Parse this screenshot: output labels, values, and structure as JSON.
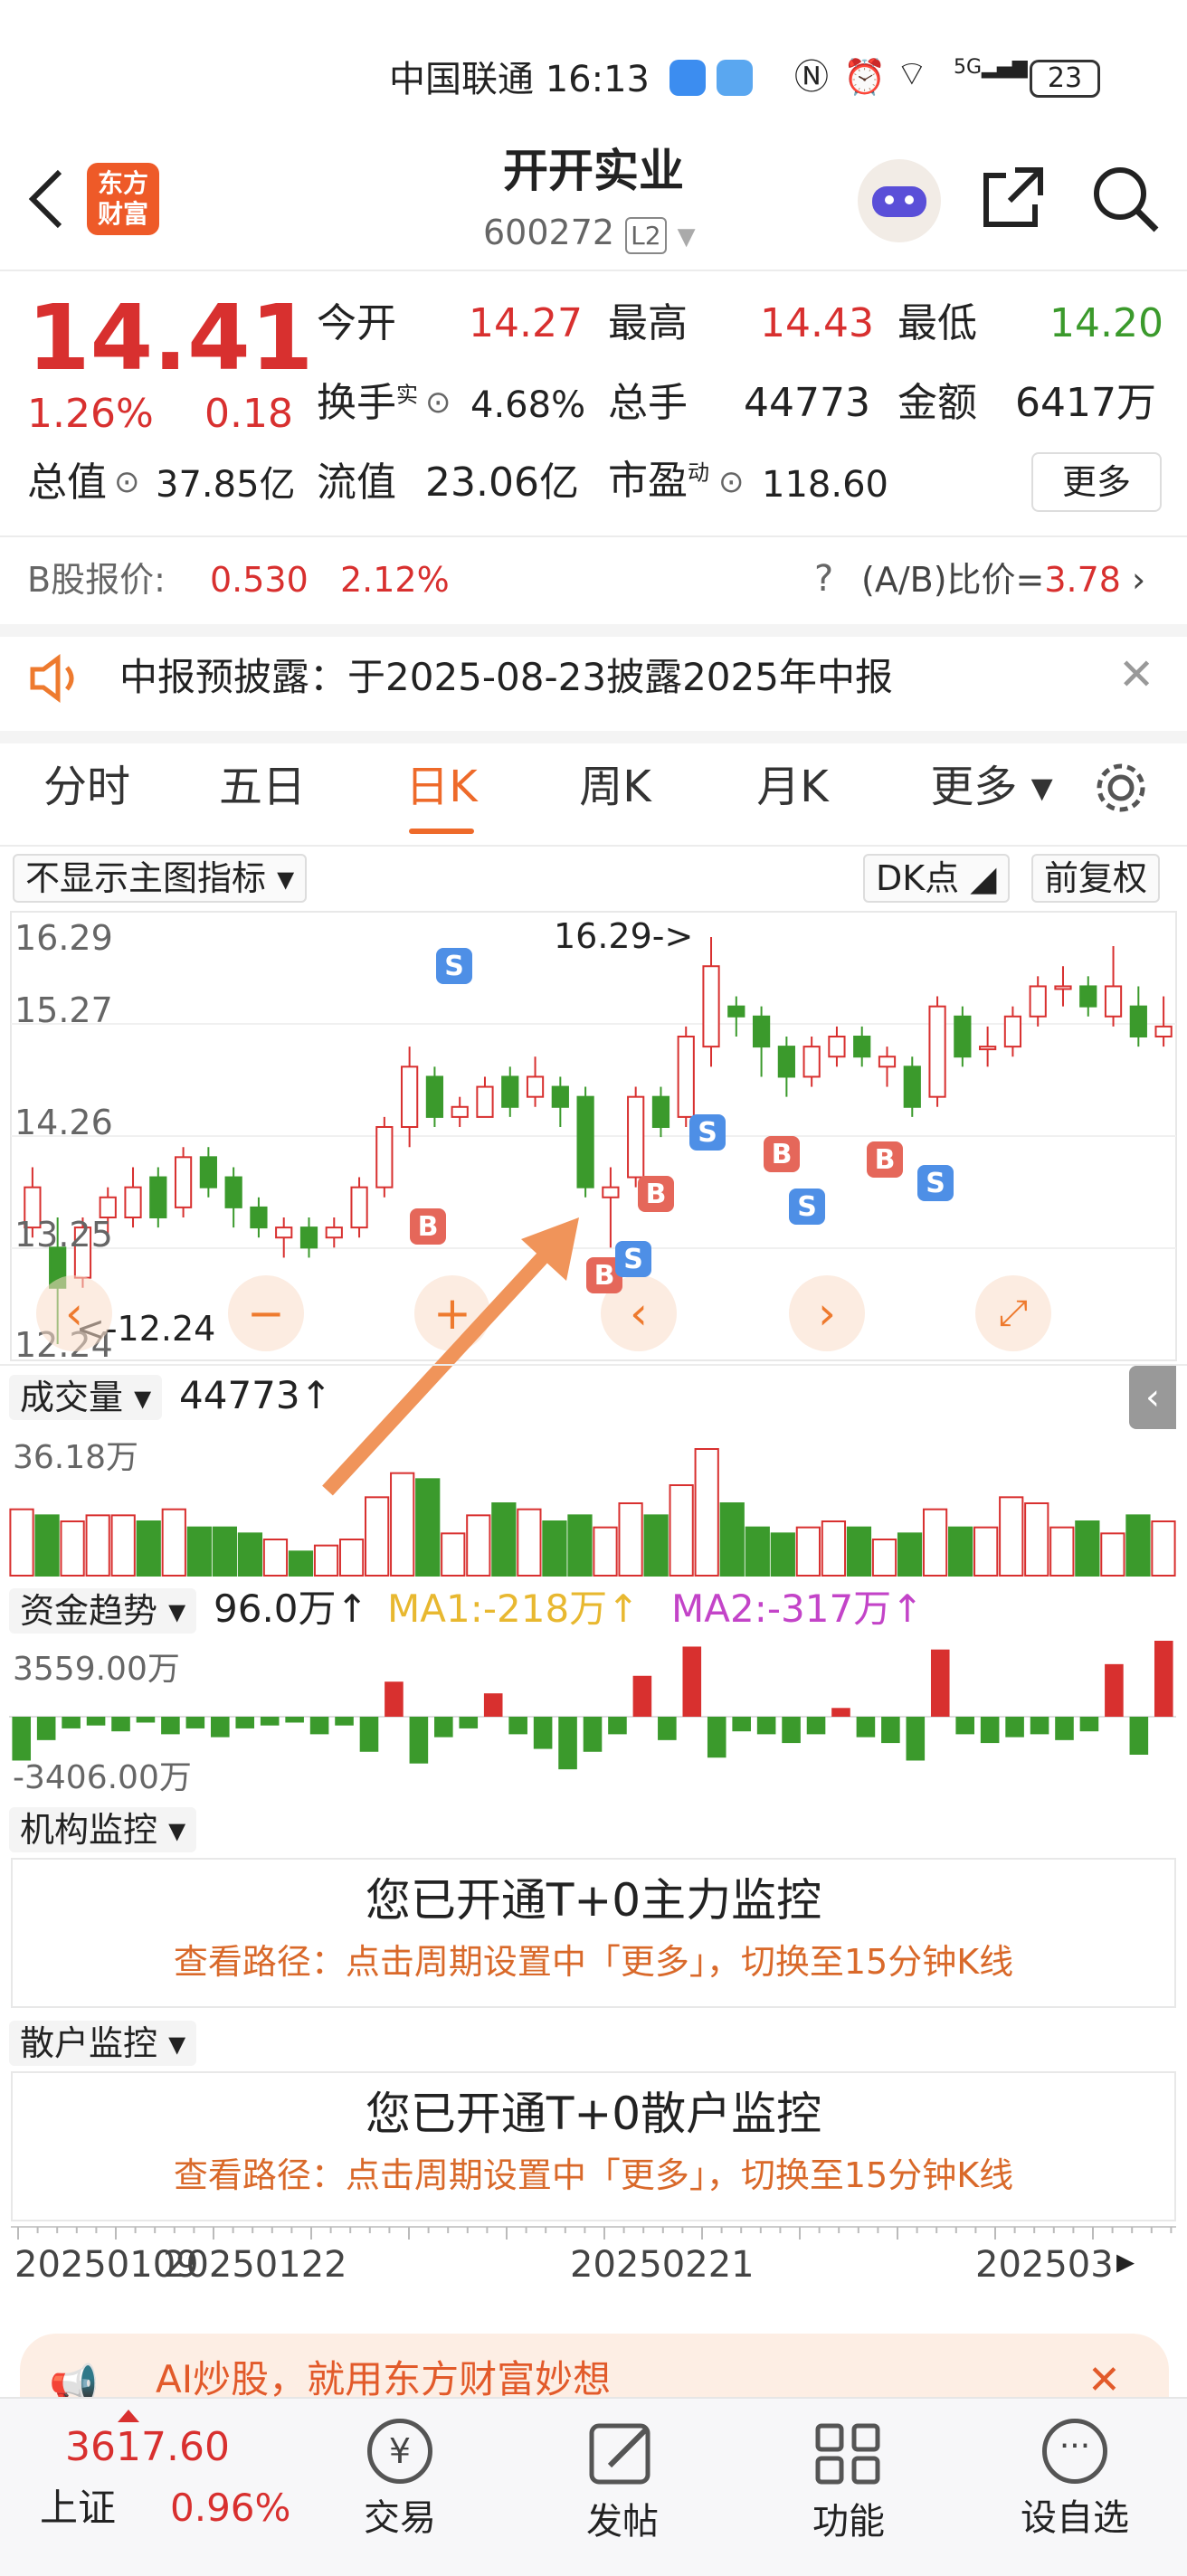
{
  "status_bar": {
    "carrier": "中国联通",
    "time": "16:13",
    "battery": "23",
    "signal": "5G"
  },
  "header": {
    "brand_line1": "东方",
    "brand_line2": "财富",
    "title": "开开实业",
    "code": "600272",
    "code_badge": "L2"
  },
  "quote": {
    "price": "14.41",
    "change_pct": "1.26%",
    "change": "0.18",
    "open_label": "今开",
    "open": "14.27",
    "high_label": "最高",
    "high": "14.43",
    "low_label": "最低",
    "low": "14.20",
    "turnover_label": "换手",
    "turnover_sup": "实",
    "turnover": "4.68%",
    "volume_label": "总手",
    "volume": "44773",
    "amount_label": "金额",
    "amount": "6417万",
    "mktcap_label": "总值",
    "mktcap": "37.85亿",
    "float_label": "流值",
    "float": "23.06亿",
    "pe_label": "市盈",
    "pe_sup": "动",
    "pe": "118.60",
    "more_button": "更多"
  },
  "bshare": {
    "label": "B股报价:",
    "price": "0.530",
    "pct": "2.12%",
    "ratio_label": "(A/B)比价=",
    "ratio": "3.78"
  },
  "notice": {
    "text": "中报预披露：于2025-08-23披露2025年中报"
  },
  "tabs": [
    "分时",
    "五日",
    "日K",
    "周K",
    "月K",
    "更多"
  ],
  "active_tab": "日K",
  "chart_toolbar": {
    "indicator": "不显示主图指标",
    "dk": "DK点",
    "adjust": "前复权"
  },
  "kline": {
    "y_labels": [
      "16.29",
      "15.27",
      "14.26",
      "13.25",
      "12.24"
    ],
    "high_marker": "16.29->",
    "low_marker": "<-12.24"
  },
  "volume": {
    "label": "成交量",
    "value": "44773↑",
    "max": "36.18万"
  },
  "capital": {
    "label": "资金趋势",
    "value": "96.0万↑",
    "ma1": "MA1:-218万↑",
    "ma2": "MA2:-317万↑",
    "max": "3559.00万",
    "min": "-3406.00万"
  },
  "inst": {
    "label": "机构监控",
    "title": "您已开通T+0主力监控",
    "hint": "查看路径：点击周期设置中「更多」，切换至15分钟K线"
  },
  "retail": {
    "label": "散户监控",
    "title": "您已开通T+0散户监控",
    "hint": "查看路径：点击周期设置中「更多」，切换至15分钟K线"
  },
  "dates": [
    "20250109",
    "20250122",
    "20250221",
    "202503"
  ],
  "ad": {
    "text": "AI炒股，就用东方财富妙想"
  },
  "bottom_nav": {
    "index_value": "3617.60",
    "index_name": "上证",
    "index_pct": "0.96%",
    "items": [
      "交易",
      "发帖",
      "功能",
      "设自选"
    ]
  },
  "colors": {
    "up": "#d8302f",
    "down": "#3b9a2c",
    "accent": "#ee7a2e",
    "buy_signal": "#e5675a",
    "sell_signal": "#4e8fe6"
  },
  "chart_data": {
    "type": "candlestick",
    "ylim": [
      12.24,
      16.29
    ],
    "candles": [
      [
        13.4,
        13.8,
        14.0,
        13.3
      ],
      [
        13.2,
        12.8,
        13.5,
        12.24
      ],
      [
        12.9,
        13.4,
        13.5,
        12.8
      ],
      [
        13.5,
        13.7,
        13.8,
        13.3
      ],
      [
        13.5,
        13.8,
        14.0,
        13.4
      ],
      [
        13.9,
        13.5,
        14.0,
        13.4
      ],
      [
        13.6,
        14.1,
        14.2,
        13.5
      ],
      [
        14.1,
        13.8,
        14.2,
        13.7
      ],
      [
        13.9,
        13.6,
        14.0,
        13.4
      ],
      [
        13.6,
        13.4,
        13.7,
        13.3
      ],
      [
        13.3,
        13.4,
        13.5,
        13.1
      ],
      [
        13.4,
        13.2,
        13.5,
        13.1
      ],
      [
        13.3,
        13.4,
        13.5,
        13.2
      ],
      [
        13.4,
        13.8,
        13.9,
        13.3
      ],
      [
        13.8,
        14.4,
        14.5,
        13.7
      ],
      [
        14.4,
        15.0,
        15.2,
        14.2
      ],
      [
        14.9,
        14.5,
        15.0,
        14.4
      ],
      [
        14.5,
        14.6,
        14.7,
        14.4
      ],
      [
        14.5,
        14.8,
        14.9,
        14.5
      ],
      [
        14.9,
        14.6,
        15.0,
        14.5
      ],
      [
        14.7,
        14.9,
        15.1,
        14.6
      ],
      [
        14.8,
        14.6,
        14.9,
        14.4
      ],
      [
        14.7,
        13.8,
        14.8,
        13.7
      ],
      [
        13.7,
        13.8,
        14.0,
        13.2
      ],
      [
        13.9,
        14.7,
        14.8,
        13.8
      ],
      [
        14.7,
        14.4,
        14.8,
        14.3
      ],
      [
        14.5,
        15.3,
        15.4,
        14.4
      ],
      [
        15.2,
        16.0,
        16.29,
        15.0
      ],
      [
        15.6,
        15.5,
        15.7,
        15.3
      ],
      [
        15.5,
        15.2,
        15.6,
        14.9
      ],
      [
        15.2,
        14.9,
        15.3,
        14.7
      ],
      [
        14.9,
        15.2,
        15.3,
        14.8
      ],
      [
        15.1,
        15.3,
        15.4,
        15.0
      ],
      [
        15.3,
        15.1,
        15.4,
        15.0
      ],
      [
        15.0,
        15.1,
        15.2,
        14.8
      ],
      [
        15.0,
        14.6,
        15.1,
        14.5
      ],
      [
        14.7,
        15.6,
        15.7,
        14.6
      ],
      [
        15.5,
        15.1,
        15.6,
        15.0
      ],
      [
        15.2,
        15.2,
        15.4,
        15.0
      ],
      [
        15.2,
        15.5,
        15.6,
        15.1
      ],
      [
        15.5,
        15.8,
        15.9,
        15.4
      ],
      [
        15.8,
        15.8,
        16.0,
        15.6
      ],
      [
        15.8,
        15.6,
        15.9,
        15.5
      ],
      [
        15.5,
        15.8,
        16.2,
        15.4
      ],
      [
        15.6,
        15.3,
        15.8,
        15.2
      ],
      [
        15.3,
        15.4,
        15.7,
        15.2
      ]
    ],
    "volumes": [
      11,
      10,
      9,
      10,
      10,
      9,
      11,
      8,
      8,
      7,
      6,
      4,
      5,
      6,
      13,
      17,
      16,
      7,
      10,
      12,
      11,
      9,
      10,
      8,
      12,
      10,
      15,
      21,
      12,
      8,
      7,
      8,
      9,
      8,
      6,
      7,
      11,
      8,
      8,
      13,
      12,
      8,
      9,
      7,
      10,
      9
    ],
    "flows": [
      -1500,
      -800,
      -400,
      -300,
      -500,
      -200,
      -600,
      -400,
      -700,
      -400,
      -300,
      -200,
      -600,
      -300,
      -1200,
      1200,
      -1600,
      -700,
      -400,
      800,
      -600,
      -1100,
      -1800,
      -1200,
      -600,
      1400,
      -800,
      2400,
      -1400,
      -500,
      -600,
      -900,
      -600,
      300,
      -700,
      -900,
      -1500,
      2300,
      -600,
      -900,
      -700,
      -600,
      -800,
      -500,
      1800,
      -1300,
      2600
    ]
  }
}
